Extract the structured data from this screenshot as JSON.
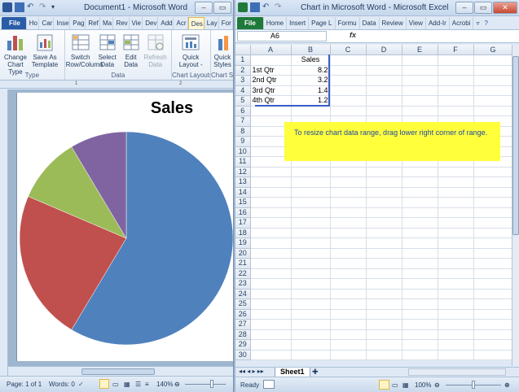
{
  "word": {
    "title": "Document1 - Microsoft Word",
    "tabs": [
      {
        "label": "File"
      },
      {
        "label": "Ho"
      },
      {
        "label": "Car"
      },
      {
        "label": "Inse"
      },
      {
        "label": "Pag"
      },
      {
        "label": "Ref"
      },
      {
        "label": "Ma"
      },
      {
        "label": "Rev"
      },
      {
        "label": "Vie"
      },
      {
        "label": "Dev"
      },
      {
        "label": "Add"
      },
      {
        "label": "Acr"
      },
      {
        "label": "Des"
      },
      {
        "label": "Lay"
      },
      {
        "label": "For"
      }
    ],
    "ribbon": {
      "type_group": {
        "label": "Type",
        "change_chart_type": "Change Chart Type",
        "save_as_template": "Save As Template"
      },
      "data_group": {
        "label": "Data",
        "switch_row_column": "Switch Row/Column",
        "select_data": "Select Data",
        "edit_data": "Edit Data",
        "refresh_data": "Refresh Data"
      },
      "layouts_group": {
        "label": "Chart Layouts",
        "quick_layout": "Quick Layout -"
      },
      "styles_group": {
        "label": "Chart St",
        "quick_styles": "Quick Styles"
      }
    },
    "ruler_marks": [
      "1",
      "2"
    ],
    "status": {
      "page": "Page: 1 of 1",
      "words": "Words: 0",
      "zoom": "140%"
    }
  },
  "excel": {
    "title": "Chart in Microsoft Word - Microsoft Excel",
    "tabs": [
      {
        "label": "File"
      },
      {
        "label": "Home"
      },
      {
        "label": "Insert"
      },
      {
        "label": "Page L"
      },
      {
        "label": "Formu"
      },
      {
        "label": "Data"
      },
      {
        "label": "Review"
      },
      {
        "label": "View"
      },
      {
        "label": "Add-Ir"
      },
      {
        "label": "Acrobi"
      }
    ],
    "name_box": "A6",
    "fx_label": "fx",
    "columns": [
      "A",
      "B",
      "C",
      "D",
      "E",
      "F",
      "G"
    ],
    "rows": [
      {
        "n": "1",
        "a": "",
        "b": "Sales"
      },
      {
        "n": "2",
        "a": "1st Qtr",
        "b": "8.2"
      },
      {
        "n": "3",
        "a": "2nd Qtr",
        "b": "3.2"
      },
      {
        "n": "4",
        "a": "3rd Qtr",
        "b": "1.4"
      },
      {
        "n": "5",
        "a": "4th Qtr",
        "b": "1.2"
      },
      {
        "n": "6",
        "a": "",
        "b": ""
      },
      {
        "n": "7",
        "a": "",
        "b": ""
      },
      {
        "n": "8",
        "a": "",
        "b": ""
      },
      {
        "n": "9",
        "a": "",
        "b": ""
      },
      {
        "n": "10",
        "a": "",
        "b": ""
      },
      {
        "n": "11",
        "a": "",
        "b": ""
      },
      {
        "n": "12",
        "a": "",
        "b": ""
      },
      {
        "n": "13",
        "a": "",
        "b": ""
      },
      {
        "n": "14",
        "a": "",
        "b": ""
      },
      {
        "n": "15",
        "a": "",
        "b": ""
      },
      {
        "n": "16",
        "a": "",
        "b": ""
      },
      {
        "n": "17",
        "a": "",
        "b": ""
      },
      {
        "n": "18",
        "a": "",
        "b": ""
      },
      {
        "n": "19",
        "a": "",
        "b": ""
      },
      {
        "n": "20",
        "a": "",
        "b": ""
      },
      {
        "n": "21",
        "a": "",
        "b": ""
      },
      {
        "n": "22",
        "a": "",
        "b": ""
      },
      {
        "n": "23",
        "a": "",
        "b": ""
      },
      {
        "n": "24",
        "a": "",
        "b": ""
      },
      {
        "n": "25",
        "a": "",
        "b": ""
      },
      {
        "n": "26",
        "a": "",
        "b": ""
      },
      {
        "n": "27",
        "a": "",
        "b": ""
      },
      {
        "n": "28",
        "a": "",
        "b": ""
      },
      {
        "n": "29",
        "a": "",
        "b": ""
      },
      {
        "n": "30",
        "a": "",
        "b": ""
      }
    ],
    "note": "To resize chart data range, drag lower right corner of range.",
    "sheet_tab": "Sheet1",
    "status": {
      "ready": "Ready",
      "zoom": "100%"
    }
  },
  "chart_data": {
    "type": "pie",
    "title": "Sales",
    "categories": [
      "1st Qtr",
      "2nd Qtr",
      "3rd Qtr",
      "4th Qtr"
    ],
    "values": [
      8.2,
      3.2,
      1.4,
      1.2
    ],
    "colors": [
      "#4f81bd",
      "#c0504d",
      "#9bbb59",
      "#8064a2"
    ]
  }
}
